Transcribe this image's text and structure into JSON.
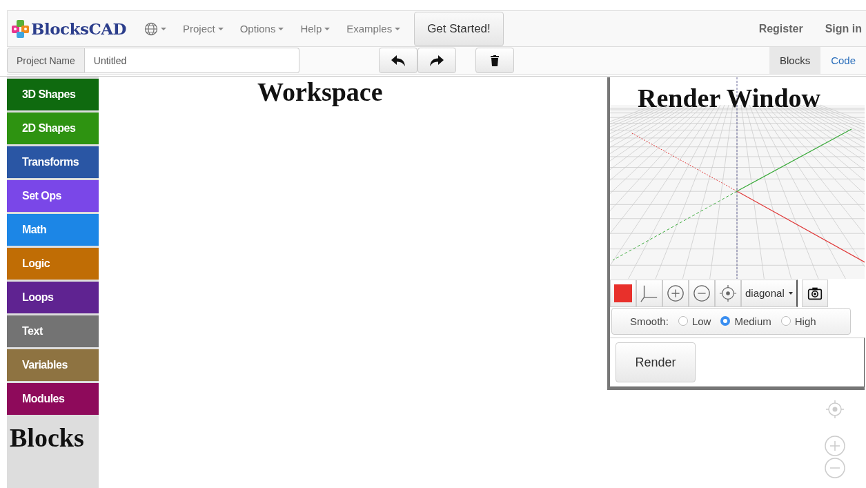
{
  "navbar": {
    "brand": "BlocksCAD",
    "menus": [
      {
        "label": "Project"
      },
      {
        "label": "Options"
      },
      {
        "label": "Help"
      },
      {
        "label": "Examples"
      }
    ],
    "cta": "Get Started!",
    "links": [
      "Register",
      "Sign in"
    ]
  },
  "toolbar": {
    "project_label": "Project Name",
    "project_name": "Untitled",
    "views": [
      {
        "label": "Blocks",
        "selected": true
      },
      {
        "label": "Code",
        "selected": false
      }
    ]
  },
  "categories": [
    {
      "label": "3D Shapes",
      "color": "#0f6a0f"
    },
    {
      "label": "2D Shapes",
      "color": "#2e9311"
    },
    {
      "label": "Transforms",
      "color": "#2a56a4"
    },
    {
      "label": "Set Ops",
      "color": "#7a47e8"
    },
    {
      "label": "Math",
      "color": "#1c86e6"
    },
    {
      "label": "Logic",
      "color": "#c06d05"
    },
    {
      "label": "Loops",
      "color": "#5f2391"
    },
    {
      "label": "Text",
      "color": "#737373"
    },
    {
      "label": "Variables",
      "color": "#8e7341"
    },
    {
      "label": "Modules",
      "color": "#8e0a5b"
    }
  ],
  "blocks_caption": "Blocks",
  "workspace_caption": "Workspace",
  "render": {
    "caption": "Render Window",
    "color_swatch": {
      "color": "#e8302b"
    },
    "view": "diagonal",
    "smooth_label": "Smooth:",
    "smooth": [
      {
        "label": "Low",
        "selected": false
      },
      {
        "label": "Medium",
        "selected": true
      },
      {
        "label": "High",
        "selected": false
      }
    ],
    "render_button": "Render"
  }
}
